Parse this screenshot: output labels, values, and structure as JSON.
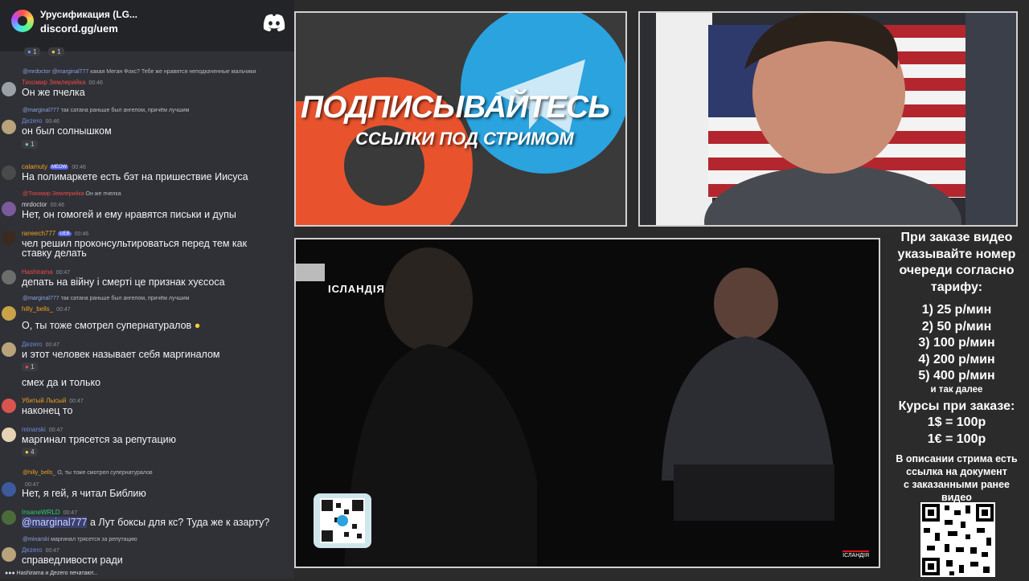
{
  "chat": {
    "server_name": "Урусификация (LG...",
    "server_link": "discord.gg/uem",
    "top_reactions": [
      "1",
      "1"
    ],
    "messages": [
      {
        "reply_user": "@mrdoctor",
        "reply_mention": "@marginal777",
        "reply_text": "какая Меган Фокс? Тебе же нравятся неподкаченные мальчики",
        "user": "Тихомир Землерийка",
        "time": "00:46",
        "text": "Он же пчелка"
      },
      {
        "reply_mention": "@marginal777",
        "reply_text": "так сатана раньше был ангелом, причём лучшим",
        "user": "Дezero",
        "time": "00:46",
        "text": "он был солнышком",
        "reaction": "1"
      },
      {
        "user": "calamuty",
        "badge": "MEOW",
        "time": "00:46",
        "text": "На полимаркете есть бэт на пришествие Иисуса"
      },
      {
        "reply_user": "@Тихомир Землерийка",
        "reply_text": "Он же пчелка",
        "user": "mrdoctor",
        "time": "00:46",
        "text": "Нет, он гомогей и ему нравятся письки и дупы"
      },
      {
        "user": "raneech777",
        "badge": "UEB",
        "time": "00:46",
        "text": "чел решил проконсультироваться перед тем как",
        "text2": "ставку делать"
      },
      {
        "user": "Hashirama",
        "time": "00:47",
        "text": "депать на війну і смерті це признак хуєсоса"
      },
      {
        "reply_mention": "@marginal777",
        "reply_text": "так сатана раньше был ангелом, причём лучшим",
        "user": "hilly_bells_",
        "time": "00:47",
        "text": "О, ты тоже смотрел супернатуралов"
      },
      {
        "user": "Дezero",
        "time": "00:47",
        "text": "и этот человек называет себя маргиналом",
        "reaction": "1",
        "text2": "смех да и только"
      },
      {
        "user": "Убитый Лысый",
        "time": "00:47",
        "text": "наконец то"
      },
      {
        "user": "minarski",
        "time": "00:47",
        "text": "маргинал трясется за репутацию",
        "reaction": "4"
      },
      {
        "reply_user": "@hilly_bells_",
        "reply_text": "О, ты тоже смотрел супернатуралов",
        "user": "",
        "time": "00:47",
        "text": "Нет, я гей, я читал Библию"
      },
      {
        "user": "InsaneWRLD",
        "time": "00:47",
        "mention": "@marginal777",
        "text": "а Лут боксы для кс? Туда же к азарту?"
      },
      {
        "reply_user": "@minarski",
        "reply_text": "маргинал трясется за репутацию",
        "user": "Дezero",
        "time": "00:47",
        "text": "справедливости ради"
      }
    ],
    "typing": "Hashirama и Дezero печатают..."
  },
  "promo": {
    "line1": "ПОДПИСЫВАЙТЕСЬ",
    "line2": "ССЫЛКИ ПОД СТРИМОМ"
  },
  "video": {
    "title": "ІСЛАНДІЯ",
    "corner_logo": "ІСЛАНДІЯ"
  },
  "info": {
    "order_text": [
      "При заказе видео",
      "указывайте номер",
      "очереди согласно",
      "тарифу:"
    ],
    "tariffs": [
      "1) 25 р/мин",
      "2) 50 р/мин",
      "3) 100 р/мин",
      "4) 200 р/мин",
      "5) 400 р/мин"
    ],
    "etc": "и так далее",
    "rates_title": "Курсы при заказе:",
    "rates": [
      "1$ = 100р",
      "1€ = 100р"
    ],
    "desc": [
      "В описании стрима есть",
      "ссылка на документ",
      "с заказанными ранее",
      "видео"
    ]
  },
  "colors": {
    "chat_bg": "#2f3136",
    "mention_bg": "#5865f2",
    "red_name": "#f04747",
    "telegram_blue": "#2aa3df",
    "patreon_orange": "#e8532d"
  }
}
